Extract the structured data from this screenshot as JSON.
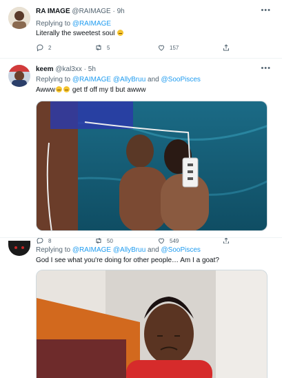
{
  "tweets": [
    {
      "name": "RA IMAGE",
      "handle": "@RAIMAGE",
      "dot": "·",
      "time": "9h",
      "replying_label": "Replying to",
      "mentions": [
        "@RAIMAGE"
      ],
      "text": "Literally the sweetest soul",
      "actions": {
        "reply_count": "2",
        "retweet_count": "5",
        "like_count": "157"
      }
    },
    {
      "name": "keem",
      "handle": "@kal3xx",
      "dot": "·",
      "time": "5h",
      "replying_label": "Replying to",
      "mentions": [
        "@RAIMAGE",
        "@AllyBruu",
        "and",
        "@SooPisces"
      ],
      "text_before": "Awww",
      "text_after": " get tf off my tl but awww",
      "actions": {
        "reply_count": "8",
        "retweet_count": "50",
        "like_count": "549"
      }
    },
    {
      "replying_label": "Replying to",
      "mentions": [
        "@RAIMAGE",
        "@AllyBruu",
        "and",
        "@SooPisces"
      ],
      "text": "God I see what you're doing for other people… Am I a goat?"
    }
  ],
  "icons": {
    "more": "more-dots-icon",
    "reply": "reply-icon",
    "retweet": "retweet-icon",
    "like": "heart-icon",
    "share": "share-icon"
  },
  "colors": {
    "accent": "#1d9bf0",
    "muted": "#536471",
    "text": "#0f1419"
  }
}
